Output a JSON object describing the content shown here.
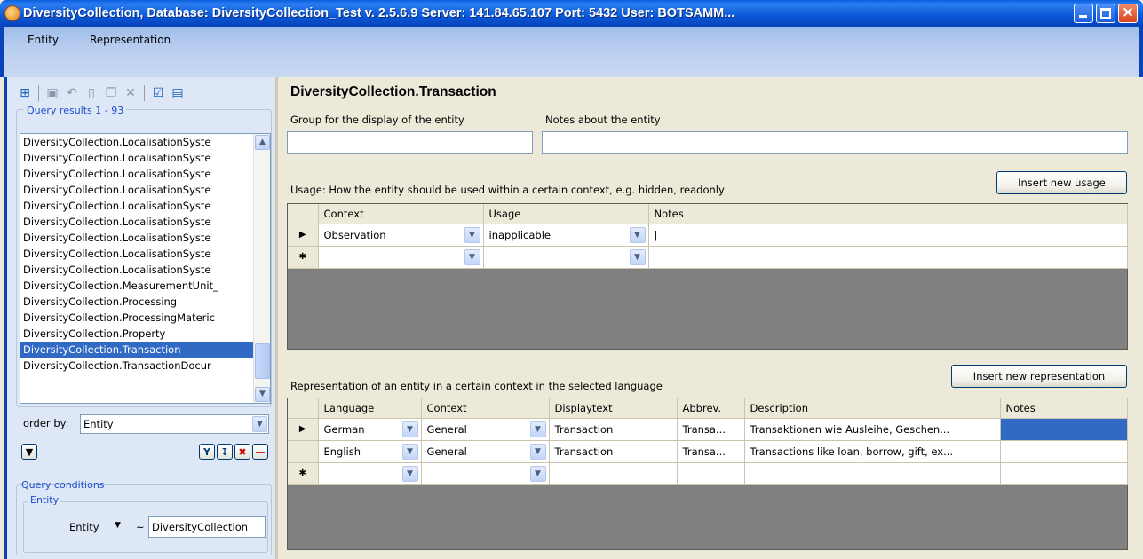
{
  "window": {
    "title": "DiversityCollection, Database: DiversityCollection_Test   v. 2.5.6.9  Server: 141.84.65.107   Port: 5432   User: BOTSAMM..."
  },
  "menu": {
    "items": [
      "Entity",
      "Representation"
    ]
  },
  "left": {
    "query_results_label": "Query results  1 - 93",
    "results": [
      "DiversityCollection.LocalisationSyste",
      "DiversityCollection.LocalisationSyste",
      "DiversityCollection.LocalisationSyste",
      "DiversityCollection.LocalisationSyste",
      "DiversityCollection.LocalisationSyste",
      "DiversityCollection.LocalisationSyste",
      "DiversityCollection.LocalisationSyste",
      "DiversityCollection.LocalisationSyste",
      "DiversityCollection.LocalisationSyste",
      "DiversityCollection.MeasurementUnit_",
      "DiversityCollection.Processing",
      "DiversityCollection.ProcessingMateric",
      "DiversityCollection.Property",
      "DiversityCollection.Transaction",
      "DiversityCollection.TransactionDocur"
    ],
    "selected_index": 13,
    "order_by_label": "order by:",
    "order_by_value": "Entity",
    "query_conditions_label": "Query conditions",
    "entity_group_label": "Entity",
    "entity_field_label": "Entity",
    "entity_operator": "~",
    "entity_value": "DiversityCollection"
  },
  "main": {
    "heading": "DiversityCollection.Transaction",
    "group_label": "Group for the display of the entity",
    "notes_label": "Notes about the entity",
    "group_value": "",
    "notes_value": "",
    "usage_label": "Usage: How the entity should be used within a certain context, e.g. hidden, readonly",
    "insert_usage_button": "Insert new usage",
    "usage_columns": [
      "Context",
      "Usage",
      "Notes"
    ],
    "usage_rows": [
      {
        "context": "Observation",
        "usage": "inapplicable",
        "notes": "|"
      }
    ],
    "representation_label": "Representation of an entity in a certain context in the selected language",
    "insert_representation_button": "Insert new representation",
    "rep_columns": [
      "Language",
      "Context",
      "Displaytext",
      "Abbrev.",
      "Description",
      "Notes"
    ],
    "rep_rows": [
      {
        "language": "German",
        "context": "General",
        "displaytext": "Transaction",
        "abbrev": "Transa...",
        "description": "Transaktionen wie Ausleihe, Geschen...",
        "notes": ""
      },
      {
        "language": "English",
        "context": "General",
        "displaytext": "Transaction",
        "abbrev": "Transa...",
        "description": "Transactions like loan, borrow, gift, ex...",
        "notes": ""
      }
    ],
    "current_row_marker": "▶",
    "new_row_marker": "✱"
  }
}
